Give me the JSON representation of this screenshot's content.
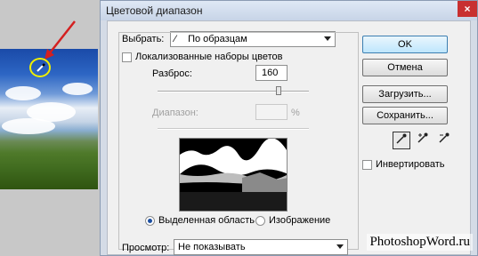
{
  "dialog": {
    "title": "Цветовой диапазон",
    "select_label": "Выбрать:",
    "select_value": "По образцам",
    "localized_label": "Локализованные наборы цветов",
    "localized_checked": false,
    "fuzziness_label": "Разброс:",
    "fuzziness_value": "160",
    "fuzziness_slider_fraction": 0.8,
    "range_label": "Диапазон:",
    "range_value": "",
    "range_unit": "%",
    "radio_selection_label": "Выделенная область",
    "radio_image_label": "Изображение",
    "selected_radio": "selection",
    "preview_label": "Просмотр:",
    "preview_value": "Не показывать",
    "invert_label": "Инвертировать",
    "invert_checked": false
  },
  "buttons": {
    "ok": "OK",
    "cancel": "Отмена",
    "load": "Загрузить...",
    "save": "Сохранить..."
  },
  "tools": [
    {
      "icon": "eyedropper-icon",
      "active": true
    },
    {
      "icon": "eyedropper-plus-icon",
      "active": false
    },
    {
      "icon": "eyedropper-minus-icon",
      "active": false
    }
  ],
  "watermark": "PhotoshopWord.ru",
  "colors": {
    "annotation_arrow": "#d42020",
    "annotation_ring": "#f0f000",
    "default_button": "#bee6fd"
  }
}
